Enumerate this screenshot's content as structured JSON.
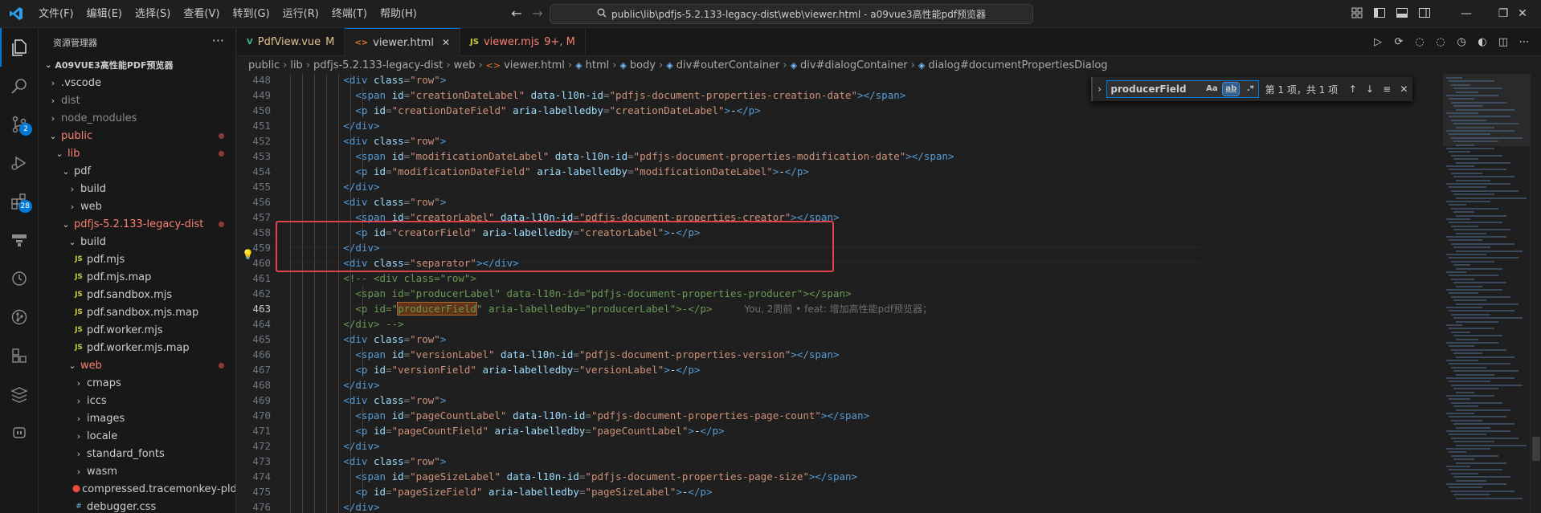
{
  "titlebar": {
    "menu": [
      "文件(F)",
      "编辑(E)",
      "选择(S)",
      "查看(V)",
      "转到(G)",
      "运行(R)",
      "终端(T)",
      "帮助(H)"
    ],
    "search_text": "public\\lib\\pdfjs-5.2.133-legacy-dist\\web\\viewer.html - a09vue3高性能pdf预览器"
  },
  "activity": {
    "scm_badge": "2",
    "extensions_badge": "28"
  },
  "sidebar": {
    "header": "资源管理器",
    "more": "···",
    "workspace": "A09VUE3高性能PDF预览器",
    "items": [
      {
        "label": ".vscode",
        "type": "folder-closed",
        "depth": 1,
        "color": "norm"
      },
      {
        "label": "dist",
        "type": "folder-closed",
        "depth": 1,
        "color": "dim"
      },
      {
        "label": "node_modules",
        "type": "folder-closed",
        "depth": 1,
        "color": "dim"
      },
      {
        "label": "public",
        "type": "folder-open",
        "depth": 1,
        "color": "mod",
        "dot": true
      },
      {
        "label": "lib",
        "type": "folder-open",
        "depth": 2,
        "color": "mod",
        "dot": true
      },
      {
        "label": "pdf",
        "type": "folder-open",
        "depth": 3,
        "color": "norm"
      },
      {
        "label": "build",
        "type": "folder-closed",
        "depth": 4,
        "color": "norm"
      },
      {
        "label": "web",
        "type": "folder-closed",
        "depth": 4,
        "color": "norm"
      },
      {
        "label": "pdfjs-5.2.133-legacy-dist",
        "type": "folder-open",
        "depth": 3,
        "color": "mod",
        "dot": true
      },
      {
        "label": "build",
        "type": "folder-open",
        "depth": 4,
        "color": "norm"
      },
      {
        "label": "pdf.mjs",
        "type": "js",
        "depth": 5,
        "color": "norm"
      },
      {
        "label": "pdf.mjs.map",
        "type": "js",
        "depth": 5,
        "color": "norm"
      },
      {
        "label": "pdf.sandbox.mjs",
        "type": "js",
        "depth": 5,
        "color": "norm"
      },
      {
        "label": "pdf.sandbox.mjs.map",
        "type": "js",
        "depth": 5,
        "color": "norm"
      },
      {
        "label": "pdf.worker.mjs",
        "type": "js",
        "depth": 5,
        "color": "norm"
      },
      {
        "label": "pdf.worker.mjs.map",
        "type": "js",
        "depth": 5,
        "color": "norm"
      },
      {
        "label": "web",
        "type": "folder-open",
        "depth": 4,
        "color": "mod",
        "dot": true
      },
      {
        "label": "cmaps",
        "type": "folder-closed",
        "depth": 5,
        "color": "norm"
      },
      {
        "label": "iccs",
        "type": "folder-closed",
        "depth": 5,
        "color": "norm"
      },
      {
        "label": "images",
        "type": "folder-closed",
        "depth": 5,
        "color": "norm"
      },
      {
        "label": "locale",
        "type": "folder-closed",
        "depth": 5,
        "color": "norm"
      },
      {
        "label": "standard_fonts",
        "type": "folder-closed",
        "depth": 5,
        "color": "norm"
      },
      {
        "label": "wasm",
        "type": "folder-closed",
        "depth": 5,
        "color": "norm"
      },
      {
        "label": "compressed.tracemonkey-pld...",
        "type": "pdf",
        "depth": 5,
        "color": "norm"
      },
      {
        "label": "debugger.css",
        "type": "css",
        "depth": 5,
        "color": "norm"
      }
    ]
  },
  "tabs": [
    {
      "label": "PdfView.vue",
      "icon": "V",
      "icon_color": "#41b883",
      "status": "M",
      "color": "#e2c08d",
      "active": false
    },
    {
      "label": "viewer.html",
      "icon": "<>",
      "icon_color": "#e37933",
      "status": "",
      "color": "#cccccc",
      "active": true,
      "close": "✕"
    },
    {
      "label": "viewer.mjs",
      "icon": "JS",
      "icon_color": "#cbcb41",
      "status": "9+, M",
      "color": "#f88070",
      "active": false
    }
  ],
  "breadcrumbs": [
    "public",
    "lib",
    "pdfjs-5.2.133-legacy-dist",
    "web",
    "viewer.html",
    "html",
    "body",
    "div#outerContainer",
    "div#dialogContainer",
    "dialog#documentPropertiesDialog"
  ],
  "find": {
    "value": "producerField",
    "opt_case": "Aa",
    "opt_word": "ab",
    "opt_regex": ".*",
    "count": "第 1 项，共 1 项"
  },
  "editor": {
    "current_line": 463,
    "blame": "You, 2周前 • feat: 增加高性能pdf预览器；",
    "lines": [
      {
        "n": 448,
        "indent": 6,
        "tokens": [
          [
            "tag",
            "<div "
          ],
          [
            "attr",
            "class"
          ],
          [
            "pun",
            "="
          ],
          [
            "str",
            "\"row\""
          ],
          [
            "tag",
            ">"
          ]
        ]
      },
      {
        "n": 449,
        "indent": 7,
        "tokens": [
          [
            "tag",
            "<span "
          ],
          [
            "attr",
            "id"
          ],
          [
            "pun",
            "="
          ],
          [
            "str",
            "\"creationDateLabel\" "
          ],
          [
            "attr",
            "data-l10n-id"
          ],
          [
            "pun",
            "="
          ],
          [
            "str",
            "\"pdfjs-document-properties-creation-date\""
          ],
          [
            "tag",
            "></span>"
          ]
        ]
      },
      {
        "n": 450,
        "indent": 7,
        "tokens": [
          [
            "tag",
            "<p "
          ],
          [
            "attr",
            "id"
          ],
          [
            "pun",
            "="
          ],
          [
            "str",
            "\"creationDateField\" "
          ],
          [
            "attr",
            "aria-labelledby"
          ],
          [
            "pun",
            "="
          ],
          [
            "str",
            "\"creationDateLabel\""
          ],
          [
            "tag",
            ">"
          ],
          [
            "txt",
            "-"
          ],
          [
            "tag",
            "</p>"
          ]
        ]
      },
      {
        "n": 451,
        "indent": 6,
        "tokens": [
          [
            "tag",
            "</div>"
          ]
        ]
      },
      {
        "n": 452,
        "indent": 6,
        "tokens": [
          [
            "tag",
            "<div "
          ],
          [
            "attr",
            "class"
          ],
          [
            "pun",
            "="
          ],
          [
            "str",
            "\"row\""
          ],
          [
            "tag",
            ">"
          ]
        ]
      },
      {
        "n": 453,
        "indent": 7,
        "tokens": [
          [
            "tag",
            "<span "
          ],
          [
            "attr",
            "id"
          ],
          [
            "pun",
            "="
          ],
          [
            "str",
            "\"modificationDateLabel\" "
          ],
          [
            "attr",
            "data-l10n-id"
          ],
          [
            "pun",
            "="
          ],
          [
            "str",
            "\"pdfjs-document-properties-modification-date\""
          ],
          [
            "tag",
            "></span>"
          ]
        ]
      },
      {
        "n": 454,
        "indent": 7,
        "tokens": [
          [
            "tag",
            "<p "
          ],
          [
            "attr",
            "id"
          ],
          [
            "pun",
            "="
          ],
          [
            "str",
            "\"modificationDateField\" "
          ],
          [
            "attr",
            "aria-labelledby"
          ],
          [
            "pun",
            "="
          ],
          [
            "str",
            "\"modificationDateLabel\""
          ],
          [
            "tag",
            ">"
          ],
          [
            "txt",
            "-"
          ],
          [
            "tag",
            "</p>"
          ]
        ]
      },
      {
        "n": 455,
        "indent": 6,
        "tokens": [
          [
            "tag",
            "</div>"
          ]
        ]
      },
      {
        "n": 456,
        "indent": 6,
        "tokens": [
          [
            "tag",
            "<div "
          ],
          [
            "attr",
            "class"
          ],
          [
            "pun",
            "="
          ],
          [
            "str",
            "\"row\""
          ],
          [
            "tag",
            ">"
          ]
        ]
      },
      {
        "n": 457,
        "indent": 7,
        "tokens": [
          [
            "tag",
            "<span "
          ],
          [
            "attr",
            "id"
          ],
          [
            "pun",
            "="
          ],
          [
            "str",
            "\"creatorLabel\" "
          ],
          [
            "attr",
            "data-l10n-id"
          ],
          [
            "pun",
            "="
          ],
          [
            "str",
            "\"pdfjs-document-properties-creator\""
          ],
          [
            "tag",
            "></span>"
          ]
        ]
      },
      {
        "n": 458,
        "indent": 7,
        "tokens": [
          [
            "tag",
            "<p "
          ],
          [
            "attr",
            "id"
          ],
          [
            "pun",
            "="
          ],
          [
            "str",
            "\"creatorField\" "
          ],
          [
            "attr",
            "aria-labelledby"
          ],
          [
            "pun",
            "="
          ],
          [
            "str",
            "\"creatorLabel\""
          ],
          [
            "tag",
            ">"
          ],
          [
            "txt",
            "-"
          ],
          [
            "tag",
            "</p>"
          ]
        ]
      },
      {
        "n": 459,
        "indent": 6,
        "tokens": [
          [
            "tag",
            "</div>"
          ]
        ]
      },
      {
        "n": 460,
        "indent": 6,
        "tokens": [
          [
            "tag",
            "<div "
          ],
          [
            "attr",
            "class"
          ],
          [
            "pun",
            "="
          ],
          [
            "str",
            "\"separator\""
          ],
          [
            "tag",
            "></div>"
          ]
        ]
      },
      {
        "n": 461,
        "indent": 6,
        "tokens": [
          [
            "com",
            "<!-- <div class=\"row\">"
          ]
        ]
      },
      {
        "n": 462,
        "indent": 7,
        "tokens": [
          [
            "com",
            "<span id=\"producerLabel\" data-l10n-id=\"pdfjs-document-properties-producer\"></span>"
          ]
        ]
      },
      {
        "n": 463,
        "indent": 7,
        "tokens": [
          [
            "com",
            "<p id=\""
          ],
          [
            "match",
            "producerField"
          ],
          [
            "com",
            "\" aria-labelledby=\"producerLabel\">-</p>"
          ]
        ],
        "blame": true
      },
      {
        "n": 464,
        "indent": 6,
        "tokens": [
          [
            "com",
            "</div> -->"
          ]
        ]
      },
      {
        "n": 465,
        "indent": 6,
        "tokens": [
          [
            "tag",
            "<div "
          ],
          [
            "attr",
            "class"
          ],
          [
            "pun",
            "="
          ],
          [
            "str",
            "\"row\""
          ],
          [
            "tag",
            ">"
          ]
        ]
      },
      {
        "n": 466,
        "indent": 7,
        "tokens": [
          [
            "tag",
            "<span "
          ],
          [
            "attr",
            "id"
          ],
          [
            "pun",
            "="
          ],
          [
            "str",
            "\"versionLabel\" "
          ],
          [
            "attr",
            "data-l10n-id"
          ],
          [
            "pun",
            "="
          ],
          [
            "str",
            "\"pdfjs-document-properties-version\""
          ],
          [
            "tag",
            "></span>"
          ]
        ]
      },
      {
        "n": 467,
        "indent": 7,
        "tokens": [
          [
            "tag",
            "<p "
          ],
          [
            "attr",
            "id"
          ],
          [
            "pun",
            "="
          ],
          [
            "str",
            "\"versionField\" "
          ],
          [
            "attr",
            "aria-labelledby"
          ],
          [
            "pun",
            "="
          ],
          [
            "str",
            "\"versionLabel\""
          ],
          [
            "tag",
            ">"
          ],
          [
            "txt",
            "-"
          ],
          [
            "tag",
            "</p>"
          ]
        ]
      },
      {
        "n": 468,
        "indent": 6,
        "tokens": [
          [
            "tag",
            "</div>"
          ]
        ]
      },
      {
        "n": 469,
        "indent": 6,
        "tokens": [
          [
            "tag",
            "<div "
          ],
          [
            "attr",
            "class"
          ],
          [
            "pun",
            "="
          ],
          [
            "str",
            "\"row\""
          ],
          [
            "tag",
            ">"
          ]
        ]
      },
      {
        "n": 470,
        "indent": 7,
        "tokens": [
          [
            "tag",
            "<span "
          ],
          [
            "attr",
            "id"
          ],
          [
            "pun",
            "="
          ],
          [
            "str",
            "\"pageCountLabel\" "
          ],
          [
            "attr",
            "data-l10n-id"
          ],
          [
            "pun",
            "="
          ],
          [
            "str",
            "\"pdfjs-document-properties-page-count\""
          ],
          [
            "tag",
            "></span>"
          ]
        ]
      },
      {
        "n": 471,
        "indent": 7,
        "tokens": [
          [
            "tag",
            "<p "
          ],
          [
            "attr",
            "id"
          ],
          [
            "pun",
            "="
          ],
          [
            "str",
            "\"pageCountField\" "
          ],
          [
            "attr",
            "aria-labelledby"
          ],
          [
            "pun",
            "="
          ],
          [
            "str",
            "\"pageCountLabel\""
          ],
          [
            "tag",
            ">"
          ],
          [
            "txt",
            "-"
          ],
          [
            "tag",
            "</p>"
          ]
        ]
      },
      {
        "n": 472,
        "indent": 6,
        "tokens": [
          [
            "tag",
            "</div>"
          ]
        ]
      },
      {
        "n": 473,
        "indent": 6,
        "tokens": [
          [
            "tag",
            "<div "
          ],
          [
            "attr",
            "class"
          ],
          [
            "pun",
            "="
          ],
          [
            "str",
            "\"row\""
          ],
          [
            "tag",
            ">"
          ]
        ]
      },
      {
        "n": 474,
        "indent": 7,
        "tokens": [
          [
            "tag",
            "<span "
          ],
          [
            "attr",
            "id"
          ],
          [
            "pun",
            "="
          ],
          [
            "str",
            "\"pageSizeLabel\" "
          ],
          [
            "attr",
            "data-l10n-id"
          ],
          [
            "pun",
            "="
          ],
          [
            "str",
            "\"pdfjs-document-properties-page-size\""
          ],
          [
            "tag",
            "></span>"
          ]
        ]
      },
      {
        "n": 475,
        "indent": 7,
        "tokens": [
          [
            "tag",
            "<p "
          ],
          [
            "attr",
            "id"
          ],
          [
            "pun",
            "="
          ],
          [
            "str",
            "\"pageSizeField\" "
          ],
          [
            "attr",
            "aria-labelledby"
          ],
          [
            "pun",
            "="
          ],
          [
            "str",
            "\"pageSizeLabel\""
          ],
          [
            "tag",
            ">"
          ],
          [
            "txt",
            "-"
          ],
          [
            "tag",
            "</p>"
          ]
        ]
      },
      {
        "n": 476,
        "indent": 6,
        "tokens": [
          [
            "tag",
            "</div>"
          ]
        ]
      }
    ]
  },
  "colors": {
    "accent": "#0078d4",
    "highlight_box": "#e0424c",
    "modified": "#f88070"
  }
}
